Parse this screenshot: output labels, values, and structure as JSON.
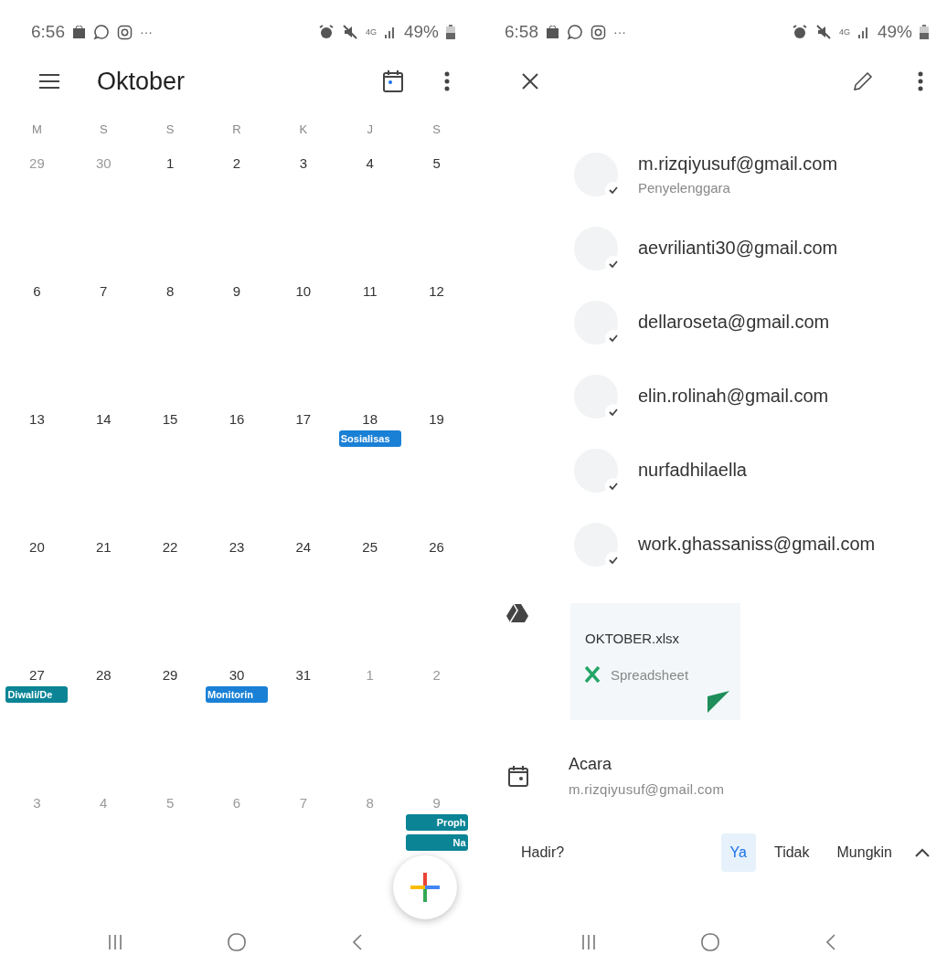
{
  "calendar_screen": {
    "status_bar": {
      "time": "6:56",
      "more": "···",
      "network": "4G",
      "battery": "49%"
    },
    "app_bar": {
      "title": "Oktober"
    },
    "weekdays": [
      "M",
      "S",
      "S",
      "R",
      "K",
      "J",
      "S"
    ],
    "weeks": [
      {
        "days": [
          {
            "label": "29",
            "muted": true
          },
          {
            "label": "30",
            "muted": true
          },
          {
            "label": "1",
            "muted": false
          },
          {
            "label": "2",
            "muted": false
          },
          {
            "label": "3",
            "muted": false
          },
          {
            "label": "4",
            "muted": false
          },
          {
            "label": "5",
            "muted": false
          }
        ]
      },
      {
        "days": [
          {
            "label": "6",
            "muted": false
          },
          {
            "label": "7",
            "muted": false
          },
          {
            "label": "8",
            "muted": false
          },
          {
            "label": "9",
            "muted": false
          },
          {
            "label": "10",
            "muted": false
          },
          {
            "label": "11",
            "muted": false
          },
          {
            "label": "12",
            "muted": false
          }
        ]
      },
      {
        "days": [
          {
            "label": "13",
            "muted": false
          },
          {
            "label": "14",
            "muted": false
          },
          {
            "label": "15",
            "muted": false
          },
          {
            "label": "16",
            "muted": false
          },
          {
            "label": "17",
            "muted": false
          },
          {
            "label": "18",
            "muted": false,
            "events": [
              {
                "title": "Sosialisas",
                "color": "#1a80d6"
              }
            ]
          },
          {
            "label": "19",
            "muted": false
          }
        ]
      },
      {
        "days": [
          {
            "label": "20",
            "muted": false
          },
          {
            "label": "21",
            "muted": false
          },
          {
            "label": "22",
            "muted": false
          },
          {
            "label": "23",
            "muted": false
          },
          {
            "label": "24",
            "muted": false
          },
          {
            "label": "25",
            "muted": false
          },
          {
            "label": "26",
            "muted": false
          }
        ]
      },
      {
        "days": [
          {
            "label": "27",
            "muted": false,
            "events": [
              {
                "title": "Diwali/De",
                "color": "#0b8496"
              }
            ]
          },
          {
            "label": "28",
            "muted": false
          },
          {
            "label": "29",
            "muted": false
          },
          {
            "label": "30",
            "muted": false,
            "events": [
              {
                "title": "Monitorin",
                "color": "#1a80d6"
              }
            ]
          },
          {
            "label": "31",
            "muted": false
          },
          {
            "label": "1",
            "muted": true
          },
          {
            "label": "2",
            "muted": true
          }
        ]
      },
      {
        "days": [
          {
            "label": "3",
            "muted": true
          },
          {
            "label": "4",
            "muted": true
          },
          {
            "label": "5",
            "muted": true
          },
          {
            "label": "6",
            "muted": true
          },
          {
            "label": "7",
            "muted": true
          },
          {
            "label": "8",
            "muted": true
          },
          {
            "label": "9",
            "muted": true,
            "events": [
              {
                "title": "Proph",
                "color": "#0b8496"
              },
              {
                "title": "Na",
                "color": "#0b8496"
              }
            ]
          }
        ]
      }
    ]
  },
  "event_screen": {
    "status_bar": {
      "time": "6:58",
      "more": "···",
      "network": "4G",
      "battery": "49%"
    },
    "guests": [
      {
        "email": "m.rizqiyusuf@gmail.com",
        "role": "Penyelenggara",
        "accepted": true
      },
      {
        "email": "aevrilianti30@gmail.com",
        "accepted": true
      },
      {
        "email": "dellaroseta@gmail.com",
        "accepted": true
      },
      {
        "email": "elin.rolinah@gmail.com",
        "accepted": true
      },
      {
        "email": "nurfadhilaella",
        "accepted": true
      },
      {
        "email": "work.ghassaniss@gmail.com",
        "accepted": true
      }
    ],
    "attachment": {
      "name": "OKTOBER.xlsx",
      "type": "Spreadsheet"
    },
    "calendar": {
      "label": "Acara",
      "owner": "m.rizqiyusuf@gmail.com"
    },
    "rsvp": {
      "question": "Hadir?",
      "options": [
        {
          "label": "Ya",
          "selected": true
        },
        {
          "label": "Tidak",
          "selected": false
        },
        {
          "label": "Mungkin",
          "selected": false
        }
      ]
    }
  }
}
